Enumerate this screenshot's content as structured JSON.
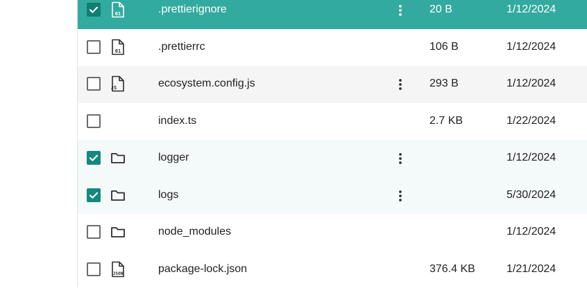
{
  "colors": {
    "selected_row": "#33aa9f",
    "checkbox_checked": "#12897c",
    "hover_row": "#f5f5f5",
    "selected_row_light": "#f3faf9"
  },
  "files": [
    {
      "name": ".prettierignore",
      "size": "20 B",
      "date": "1/12/2024",
      "icon": "file-binary-icon",
      "badge": "01",
      "checked": true,
      "state": "selected",
      "menu": true
    },
    {
      "name": ".prettierrc",
      "size": "106 B",
      "date": "1/12/2024",
      "icon": "file-binary-icon",
      "badge": "01",
      "checked": false,
      "state": "normal",
      "menu": false
    },
    {
      "name": "ecosystem.config.js",
      "size": "293 B",
      "date": "1/12/2024",
      "icon": "file-js-icon",
      "badge": "JS",
      "checked": false,
      "state": "hover",
      "menu": true
    },
    {
      "name": "index.ts",
      "size": "2.7 KB",
      "date": "1/22/2024",
      "icon": "",
      "badge": "",
      "checked": false,
      "state": "normal",
      "menu": false
    },
    {
      "name": "logger",
      "size": "",
      "date": "1/12/2024",
      "icon": "folder-icon",
      "badge": "",
      "checked": true,
      "state": "selected-light",
      "menu": true
    },
    {
      "name": "logs",
      "size": "",
      "date": "5/30/2024",
      "icon": "folder-icon",
      "badge": "",
      "checked": true,
      "state": "selected-light",
      "menu": true
    },
    {
      "name": "node_modules",
      "size": "",
      "date": "1/12/2024",
      "icon": "folder-icon",
      "badge": "",
      "checked": false,
      "state": "normal",
      "menu": false
    },
    {
      "name": "package-lock.json",
      "size": "376.4 KB",
      "date": "1/21/2024",
      "icon": "file-json-icon",
      "badge": "JSON",
      "checked": false,
      "state": "normal",
      "menu": false
    }
  ]
}
